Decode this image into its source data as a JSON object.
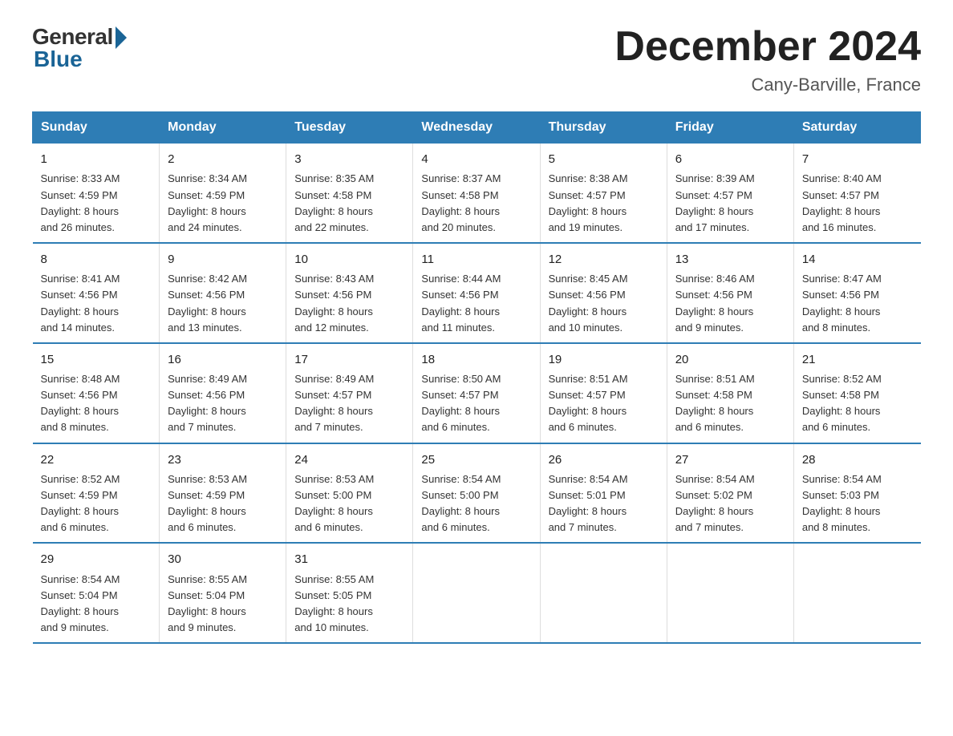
{
  "header": {
    "logo_general": "General",
    "logo_blue": "Blue",
    "title": "December 2024",
    "subtitle": "Cany-Barville, France"
  },
  "days_of_week": [
    "Sunday",
    "Monday",
    "Tuesday",
    "Wednesday",
    "Thursday",
    "Friday",
    "Saturday"
  ],
  "weeks": [
    [
      {
        "day": "1",
        "sunrise": "8:33 AM",
        "sunset": "4:59 PM",
        "daylight": "8 hours and 26 minutes."
      },
      {
        "day": "2",
        "sunrise": "8:34 AM",
        "sunset": "4:59 PM",
        "daylight": "8 hours and 24 minutes."
      },
      {
        "day": "3",
        "sunrise": "8:35 AM",
        "sunset": "4:58 PM",
        "daylight": "8 hours and 22 minutes."
      },
      {
        "day": "4",
        "sunrise": "8:37 AM",
        "sunset": "4:58 PM",
        "daylight": "8 hours and 20 minutes."
      },
      {
        "day": "5",
        "sunrise": "8:38 AM",
        "sunset": "4:57 PM",
        "daylight": "8 hours and 19 minutes."
      },
      {
        "day": "6",
        "sunrise": "8:39 AM",
        "sunset": "4:57 PM",
        "daylight": "8 hours and 17 minutes."
      },
      {
        "day": "7",
        "sunrise": "8:40 AM",
        "sunset": "4:57 PM",
        "daylight": "8 hours and 16 minutes."
      }
    ],
    [
      {
        "day": "8",
        "sunrise": "8:41 AM",
        "sunset": "4:56 PM",
        "daylight": "8 hours and 14 minutes."
      },
      {
        "day": "9",
        "sunrise": "8:42 AM",
        "sunset": "4:56 PM",
        "daylight": "8 hours and 13 minutes."
      },
      {
        "day": "10",
        "sunrise": "8:43 AM",
        "sunset": "4:56 PM",
        "daylight": "8 hours and 12 minutes."
      },
      {
        "day": "11",
        "sunrise": "8:44 AM",
        "sunset": "4:56 PM",
        "daylight": "8 hours and 11 minutes."
      },
      {
        "day": "12",
        "sunrise": "8:45 AM",
        "sunset": "4:56 PM",
        "daylight": "8 hours and 10 minutes."
      },
      {
        "day": "13",
        "sunrise": "8:46 AM",
        "sunset": "4:56 PM",
        "daylight": "8 hours and 9 minutes."
      },
      {
        "day": "14",
        "sunrise": "8:47 AM",
        "sunset": "4:56 PM",
        "daylight": "8 hours and 8 minutes."
      }
    ],
    [
      {
        "day": "15",
        "sunrise": "8:48 AM",
        "sunset": "4:56 PM",
        "daylight": "8 hours and 8 minutes."
      },
      {
        "day": "16",
        "sunrise": "8:49 AM",
        "sunset": "4:56 PM",
        "daylight": "8 hours and 7 minutes."
      },
      {
        "day": "17",
        "sunrise": "8:49 AM",
        "sunset": "4:57 PM",
        "daylight": "8 hours and 7 minutes."
      },
      {
        "day": "18",
        "sunrise": "8:50 AM",
        "sunset": "4:57 PM",
        "daylight": "8 hours and 6 minutes."
      },
      {
        "day": "19",
        "sunrise": "8:51 AM",
        "sunset": "4:57 PM",
        "daylight": "8 hours and 6 minutes."
      },
      {
        "day": "20",
        "sunrise": "8:51 AM",
        "sunset": "4:58 PM",
        "daylight": "8 hours and 6 minutes."
      },
      {
        "day": "21",
        "sunrise": "8:52 AM",
        "sunset": "4:58 PM",
        "daylight": "8 hours and 6 minutes."
      }
    ],
    [
      {
        "day": "22",
        "sunrise": "8:52 AM",
        "sunset": "4:59 PM",
        "daylight": "8 hours and 6 minutes."
      },
      {
        "day": "23",
        "sunrise": "8:53 AM",
        "sunset": "4:59 PM",
        "daylight": "8 hours and 6 minutes."
      },
      {
        "day": "24",
        "sunrise": "8:53 AM",
        "sunset": "5:00 PM",
        "daylight": "8 hours and 6 minutes."
      },
      {
        "day": "25",
        "sunrise": "8:54 AM",
        "sunset": "5:00 PM",
        "daylight": "8 hours and 6 minutes."
      },
      {
        "day": "26",
        "sunrise": "8:54 AM",
        "sunset": "5:01 PM",
        "daylight": "8 hours and 7 minutes."
      },
      {
        "day": "27",
        "sunrise": "8:54 AM",
        "sunset": "5:02 PM",
        "daylight": "8 hours and 7 minutes."
      },
      {
        "day": "28",
        "sunrise": "8:54 AM",
        "sunset": "5:03 PM",
        "daylight": "8 hours and 8 minutes."
      }
    ],
    [
      {
        "day": "29",
        "sunrise": "8:54 AM",
        "sunset": "5:04 PM",
        "daylight": "8 hours and 9 minutes."
      },
      {
        "day": "30",
        "sunrise": "8:55 AM",
        "sunset": "5:04 PM",
        "daylight": "8 hours and 9 minutes."
      },
      {
        "day": "31",
        "sunrise": "8:55 AM",
        "sunset": "5:05 PM",
        "daylight": "8 hours and 10 minutes."
      },
      null,
      null,
      null,
      null
    ]
  ],
  "labels": {
    "sunrise": "Sunrise:",
    "sunset": "Sunset:",
    "daylight": "Daylight:"
  }
}
